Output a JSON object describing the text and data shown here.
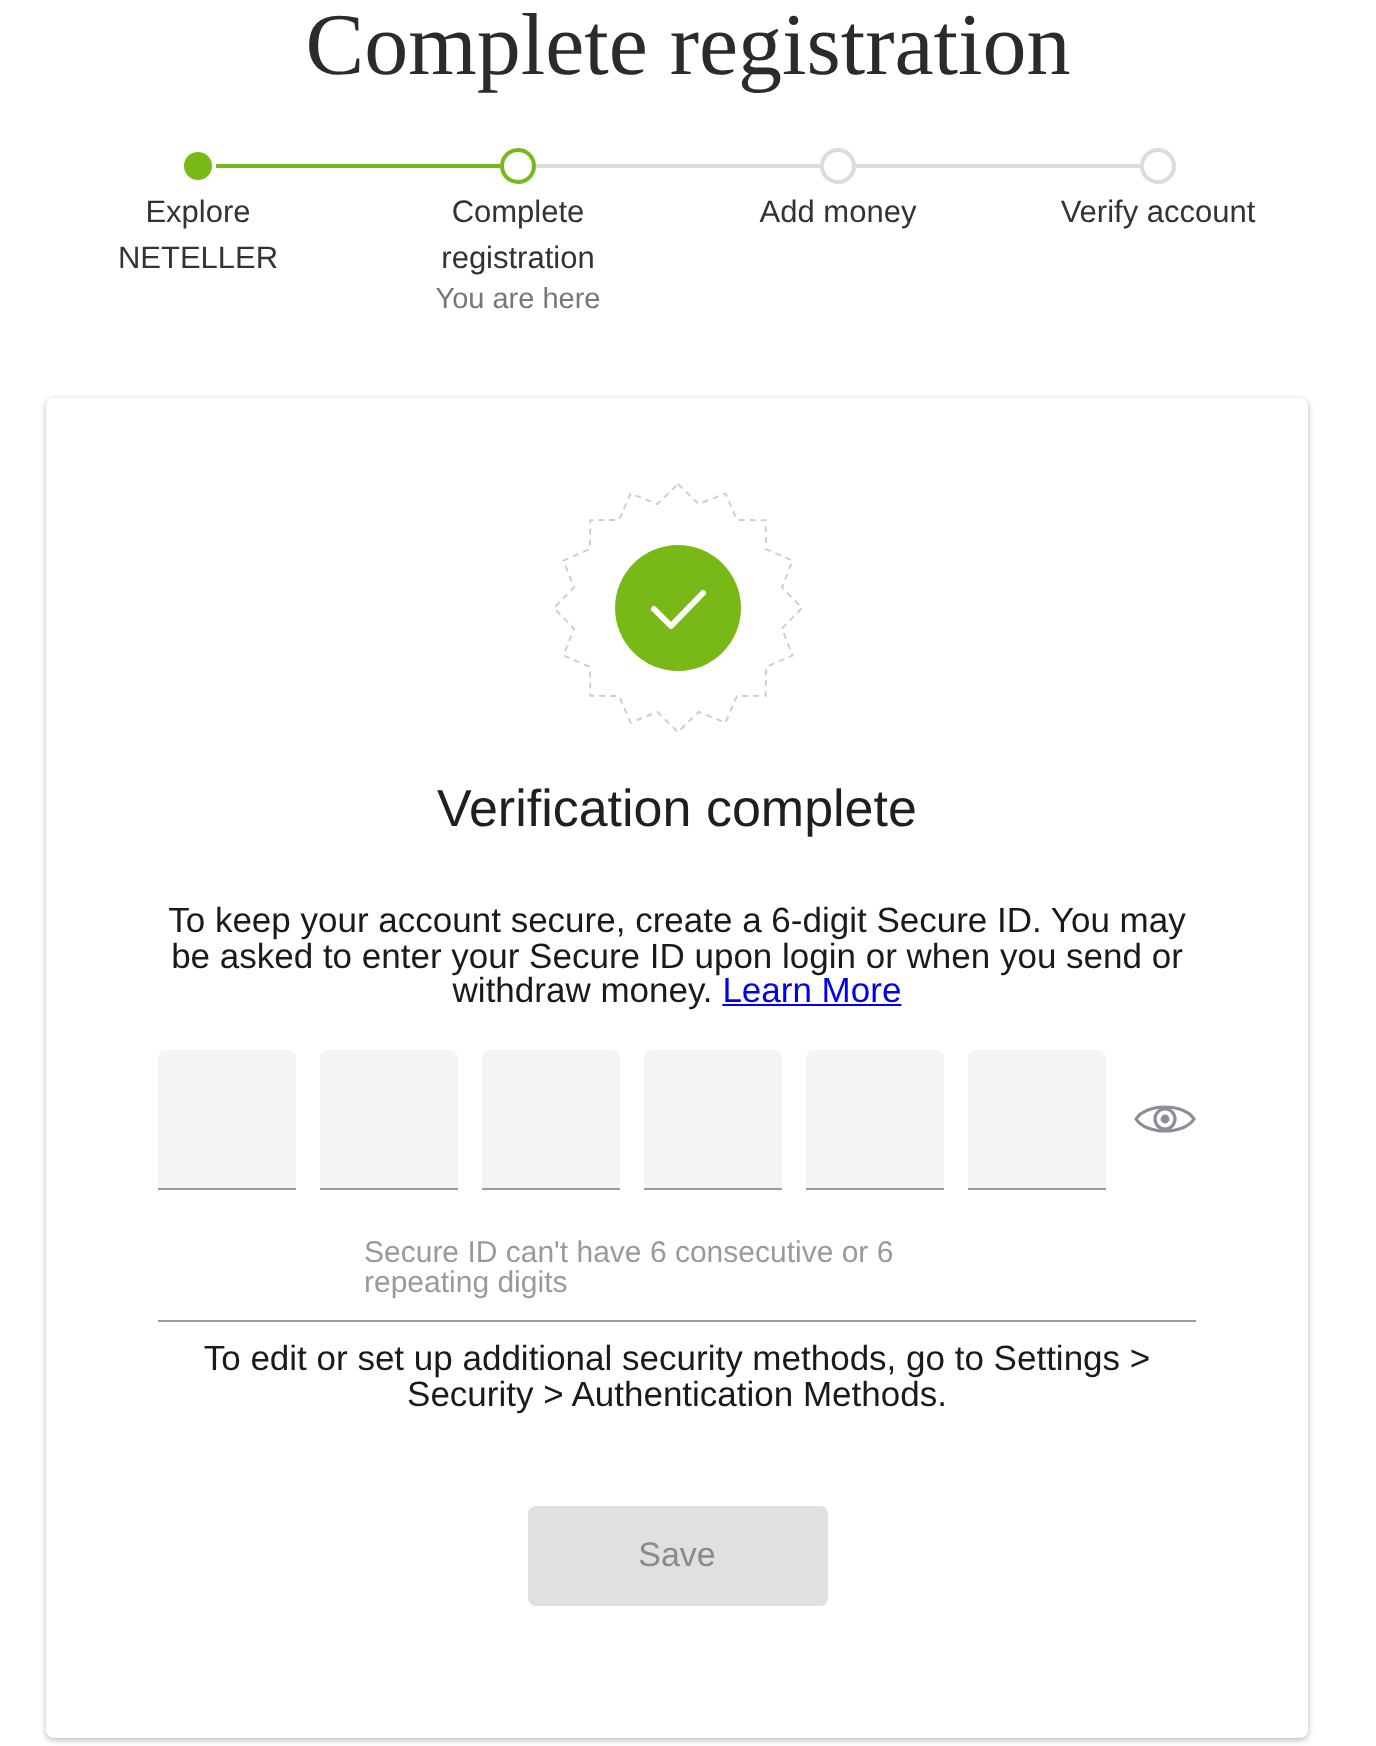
{
  "page_title": "Complete registration",
  "steps": [
    {
      "label": "Explore NETELLER",
      "done": true,
      "selected": false
    },
    {
      "label": "Complete registration",
      "done": false,
      "selected": true,
      "note": "You are here"
    },
    {
      "label": "Add money",
      "done": false,
      "selected": false
    },
    {
      "label": "Verify account",
      "done": false,
      "selected": false
    }
  ],
  "card": {
    "heading": "Verification complete",
    "intro": "To keep your account secure, create a 6-digit Secure ID. You may be asked to enter your Secure ID upon login or when you send or withdraw money.",
    "link": "Learn More",
    "digit_fields": [
      {
        "focused": false
      },
      {
        "focused": false
      },
      {
        "focused": false
      },
      {
        "focused": false
      },
      {
        "focused": false
      },
      {
        "focused": false
      }
    ],
    "hint": "Secure ID can't have 6 consecutive or 6 repeating digits",
    "settings_note": "To edit or set up additional security methods, go to Settings > Security > Authentication Methods.",
    "save_button": {
      "label": "Save",
      "disabled": true
    }
  }
}
